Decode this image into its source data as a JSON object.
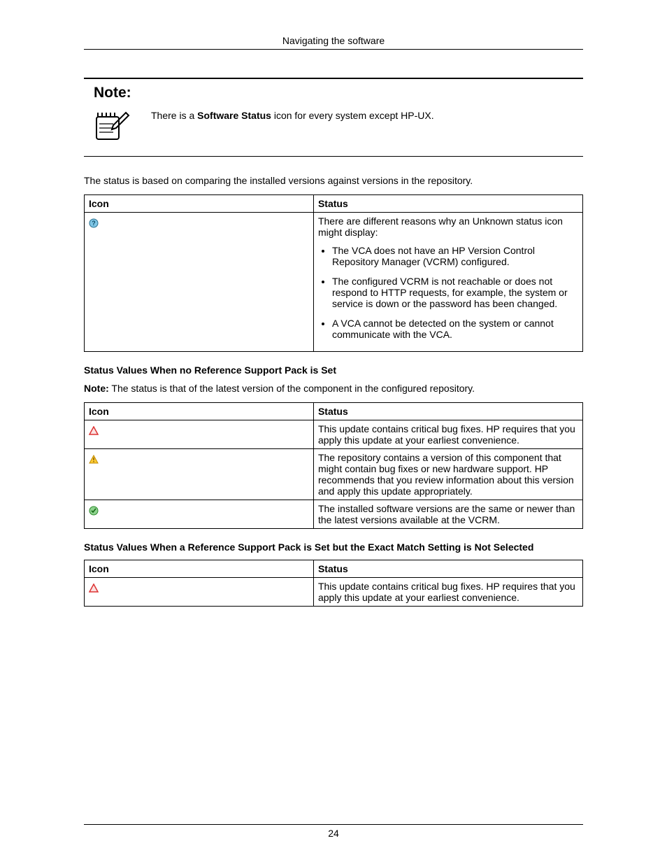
{
  "header": "Navigating the software",
  "note": {
    "title": "Note:",
    "text_pre": "There is a ",
    "text_bold": "Software Status",
    "text_post": " icon for every system except HP-UX."
  },
  "para1": "The status is based on comparing the installed versions against versions in the repository.",
  "table1": {
    "h1": "Icon",
    "h2": "Status",
    "row1": {
      "icon": "unknown-icon",
      "lead_pre": "There are different reasons why an ",
      "lead_bold": "Unknown",
      "lead_post": " status icon might display:",
      "li1": "The VCA does not have an HP Version Control Repository Manager (VCRM) configured.",
      "li2": "The configured VCRM is not reachable or does not respond to HTTP requests, for example, the system or service is down or the password has been changed.",
      "li3": "A VCA cannot be detected on the system or cannot communicate with the VCA."
    }
  },
  "sub1": "Status Values When no Reference Support Pack is Set",
  "note2_label": "Note:",
  "note2_text": " The status is that of the latest version of the component in the configured repository.",
  "table2": {
    "h1": "Icon",
    "h2": "Status",
    "r1": {
      "icon": "critical-icon",
      "text": "This update contains critical bug fixes. HP requires that you apply this update at your earliest convenience."
    },
    "r2": {
      "icon": "warning-icon",
      "text": "The repository contains a version of this component that might contain bug fixes or new hardware support. HP recommends that you review information about this version and apply this update appropriately."
    },
    "r3": {
      "icon": "ok-icon",
      "text": "The installed software versions are the same or newer than the latest versions available at the VCRM."
    }
  },
  "sub2": "Status Values When a Reference Support Pack is Set but the Exact Match Setting is Not Selected",
  "table3": {
    "h1": "Icon",
    "h2": "Status",
    "r1": {
      "icon": "critical-icon",
      "text": "This update contains critical bug fixes. HP requires that you apply this update at your earliest convenience."
    }
  },
  "page_number": "24"
}
